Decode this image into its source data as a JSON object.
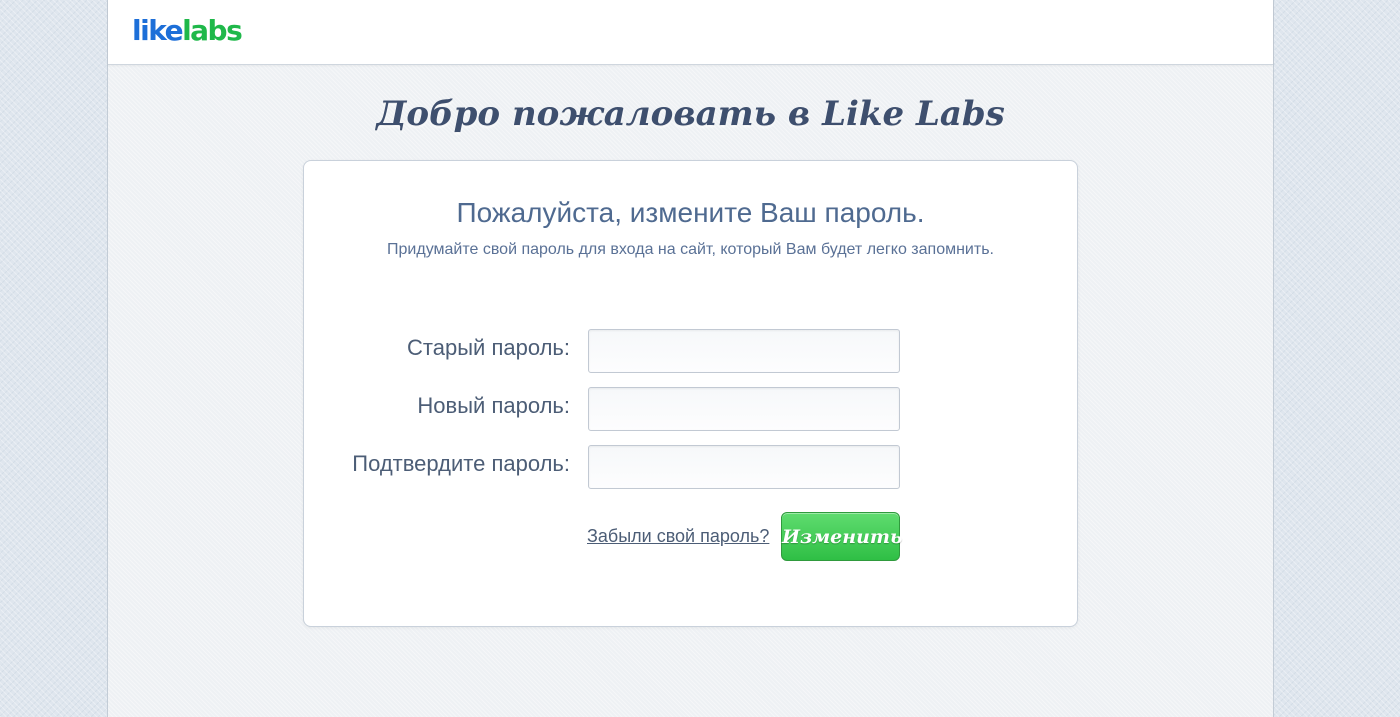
{
  "brand": {
    "logo_part1": "like",
    "logo_part2": "labs",
    "color_like": "#1d6fd8",
    "color_labs": "#1fb84a"
  },
  "welcome_heading": "Добро пожаловать в Like Labs",
  "card": {
    "title": "Пожалуйста, измените Ваш пароль.",
    "subtitle": "Придумайте свой пароль для входа на сайт, который Вам будет легко запомнить."
  },
  "form": {
    "fields": [
      {
        "label": "Старый пароль:",
        "value": "",
        "placeholder": ""
      },
      {
        "label": "Новый пароль:",
        "value": "",
        "placeholder": ""
      },
      {
        "label": "Подтвердите пароль:",
        "value": "",
        "placeholder": ""
      }
    ],
    "forgot_link": "Забыли свой пароль?",
    "submit_label": "Изменить"
  },
  "colors": {
    "accent_green": "#2fbf45",
    "text_primary": "#4c5d76"
  }
}
